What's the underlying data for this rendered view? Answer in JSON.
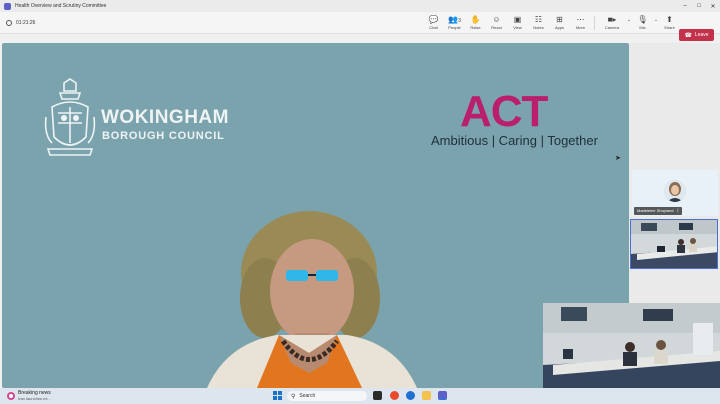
{
  "window": {
    "title": "Health Overview and Scrutiny Committee",
    "controls": [
      "–",
      "□",
      "✕"
    ]
  },
  "meeting": {
    "elapsed": "01:21:26",
    "tools": [
      {
        "name": "chat",
        "label": "Chat",
        "icon": "chat-icon",
        "glyph": "💬"
      },
      {
        "name": "people",
        "label": "People",
        "icon": "people-icon",
        "glyph": "👥"
      },
      {
        "name": "raise",
        "label": "Raise",
        "icon": "raise-hand-icon",
        "glyph": "✋"
      },
      {
        "name": "react",
        "label": "React",
        "icon": "react-icon",
        "glyph": "☺"
      },
      {
        "name": "view",
        "label": "View",
        "icon": "view-icon",
        "glyph": "▣"
      },
      {
        "name": "notes",
        "label": "Notes",
        "icon": "notes-icon",
        "glyph": "☷"
      },
      {
        "name": "apps",
        "label": "Apps",
        "icon": "apps-icon",
        "glyph": "⊞"
      },
      {
        "name": "more",
        "label": "More",
        "icon": "more-icon",
        "glyph": "⋯"
      }
    ],
    "people_count": "3",
    "camera_label": "Camera",
    "mic_label": "Mic",
    "share_label": "Share",
    "leave_label": "Leave"
  },
  "stage": {
    "org_name": "WOKINGHAM",
    "org_sub": "BOROUGH COUNCIL",
    "act_logo": "ACT",
    "act_tagline": "Ambitious | Caring | Together"
  },
  "participants": [
    {
      "name": "Madeleine Shopland",
      "muted": true
    }
  ],
  "taskbar": {
    "news_title": "Breaking news",
    "news_sub": "Iran launches mi...",
    "search_label": "Search"
  },
  "colors": {
    "stage_bg": "#7ba3ad",
    "leave": "#c4314b",
    "act": "#b91f6b",
    "teams": "#5b5fc7"
  }
}
